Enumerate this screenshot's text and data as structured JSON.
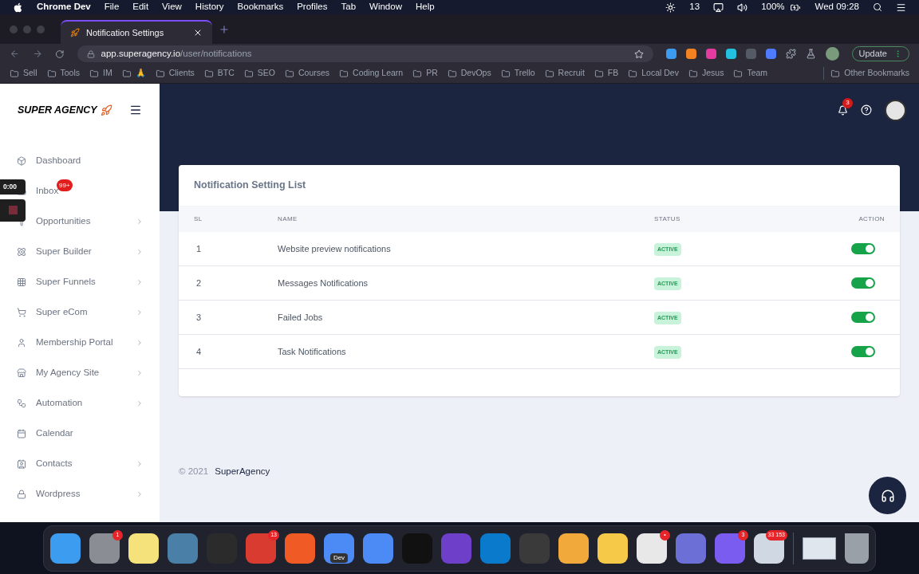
{
  "menubar": {
    "app": "Chrome Dev",
    "menus": [
      "File",
      "Edit",
      "View",
      "History",
      "Bookmarks",
      "Profiles",
      "Tab",
      "Window",
      "Help"
    ],
    "todo_count": "13",
    "battery": "100%",
    "clock": "Wed 09:28"
  },
  "browser": {
    "tab_title": "Notification Settings",
    "url_host": "app.superagency.io",
    "url_path": "/user/notifications",
    "update_label": "Update",
    "bookmarks": [
      {
        "label": "Sell"
      },
      {
        "label": "Tools"
      },
      {
        "label": "IM"
      },
      {
        "label": "🙏"
      },
      {
        "label": "Clients"
      },
      {
        "label": "BTC"
      },
      {
        "label": "SEO"
      },
      {
        "label": "Courses"
      },
      {
        "label": "Coding Learn"
      },
      {
        "label": "PR"
      },
      {
        "label": "DevOps"
      },
      {
        "label": "Trello"
      },
      {
        "label": "Recruit"
      },
      {
        "label": "FB"
      },
      {
        "label": "Local Dev"
      },
      {
        "label": "Jesus"
      },
      {
        "label": "Team"
      }
    ],
    "other_bookmarks": "Other Bookmarks"
  },
  "sidebar": {
    "brand": "SUPER AGENCY",
    "items": [
      {
        "label": "Dashboard",
        "submenu": false
      },
      {
        "label": "Inbox",
        "submenu": false,
        "badge": "99+"
      },
      {
        "label": "Opportunities",
        "submenu": true
      },
      {
        "label": "Super Builder",
        "submenu": true
      },
      {
        "label": "Super Funnels",
        "submenu": true
      },
      {
        "label": "Super eCom",
        "submenu": true
      },
      {
        "label": "Membership Portal",
        "submenu": true
      },
      {
        "label": "My Agency Site",
        "submenu": true
      },
      {
        "label": "Automation",
        "submenu": true
      },
      {
        "label": "Calendar",
        "submenu": false
      },
      {
        "label": "Contacts",
        "submenu": true
      },
      {
        "label": "Wordpress",
        "submenu": true
      }
    ]
  },
  "recorder": {
    "time": "0:00"
  },
  "header": {
    "notification_count": "3"
  },
  "card": {
    "title": "Notification Setting List",
    "columns": [
      "SL",
      "NAME",
      "STATUS",
      "ACTION"
    ],
    "rows": [
      {
        "sl": "1",
        "name": "Website preview notifications",
        "status": "ACTIVE",
        "on": true
      },
      {
        "sl": "2",
        "name": "Messages Notifications",
        "status": "ACTIVE",
        "on": true
      },
      {
        "sl": "3",
        "name": "Failed Jobs",
        "status": "ACTIVE",
        "on": true
      },
      {
        "sl": "4",
        "name": "Task Notifications",
        "status": "ACTIVE",
        "on": true
      }
    ]
  },
  "footer": {
    "copyright": "© 2021",
    "brand": "SuperAgency"
  },
  "dock": [
    {
      "color": "#3b9cf0"
    },
    {
      "color": "#8a8d93",
      "badge": "1"
    },
    {
      "color": "#f6e27a"
    },
    {
      "color": "#4a7fa8"
    },
    {
      "color": "#2b2b2b"
    },
    {
      "color": "#d93b30",
      "badge": "13"
    },
    {
      "color": "#f05a24"
    },
    {
      "color": "#4c8bf5",
      "label": "Dev"
    },
    {
      "color": "#4c8bf5"
    },
    {
      "color": "#111111"
    },
    {
      "color": "#6e40c9"
    },
    {
      "color": "#0a7acc"
    },
    {
      "color": "#3a3a3a"
    },
    {
      "color": "#f2a93b"
    },
    {
      "color": "#f7c948"
    },
    {
      "color": "#e8e8e8",
      "badge": "•"
    },
    {
      "color": "#6b6fd6"
    },
    {
      "color": "#7b5cf0",
      "badge": "3"
    },
    {
      "color": "#cfd8e3",
      "badge": "33 153"
    }
  ]
}
